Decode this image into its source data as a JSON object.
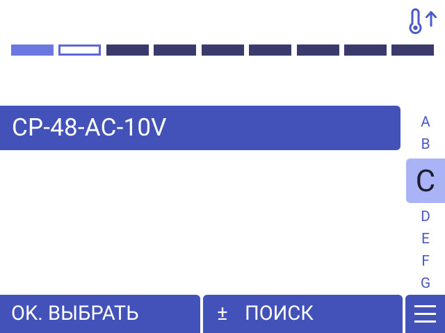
{
  "status": {
    "icon": "thermometer-up-icon"
  },
  "progress": {
    "total_steps": 9,
    "completed_steps": 1,
    "current_step": 2
  },
  "list": {
    "selected_item": "CP-48-AC-10V"
  },
  "index": {
    "letters": [
      "A",
      "B",
      "C",
      "D",
      "E",
      "F",
      "G"
    ],
    "selected": "C"
  },
  "actions": {
    "ok_label": "OK. ВЫБРАТЬ",
    "search_symbol": "±",
    "search_label": "ПОИСК",
    "menu_icon": "hamburger-menu-icon"
  },
  "colors": {
    "primary": "#4352b8",
    "step_done": "#6a78e0",
    "step_pending": "#3a3a6c",
    "index_selected_bg": "#a9b3f5",
    "index_text": "#4a5ac8"
  }
}
